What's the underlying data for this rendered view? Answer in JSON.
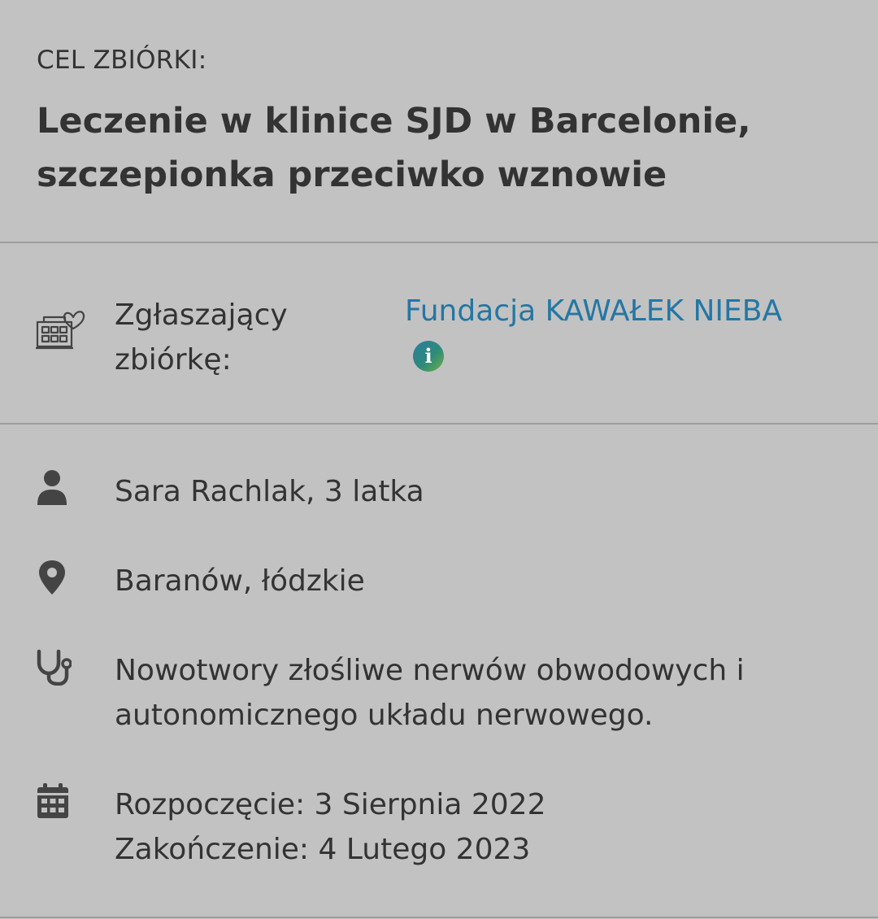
{
  "goal": {
    "label": "CEL ZBIÓRKI:",
    "title": "Leczenie w klinice SJD w Barcelonie, szczepionka przeciwko wznowie"
  },
  "organizer": {
    "icon": "hospital-heart-icon",
    "label": "Zgłaszający zbiórkę:",
    "name": "Fundacja KAWAŁEK NIEBA",
    "info_icon": "info-icon"
  },
  "details": {
    "person": {
      "icon": "person-icon",
      "text": "Sara Rachlak, 3 latka"
    },
    "location": {
      "icon": "map-pin-icon",
      "text": "Baranów, łódzkie"
    },
    "diagnosis": {
      "icon": "stethoscope-icon",
      "text": "Nowotwory złośliwe nerwów obwodowych i autonomicznego układu nerwowego."
    },
    "dates": {
      "icon": "calendar-icon",
      "start": "Rozpoczęcie: 3 Sierpnia 2022",
      "end": "Zakończenie: 4 Lutego 2023"
    }
  },
  "colors": {
    "background": "#c2c2c2",
    "text": "#333333",
    "link": "#2377a4",
    "divider": "#9d9d9d"
  }
}
